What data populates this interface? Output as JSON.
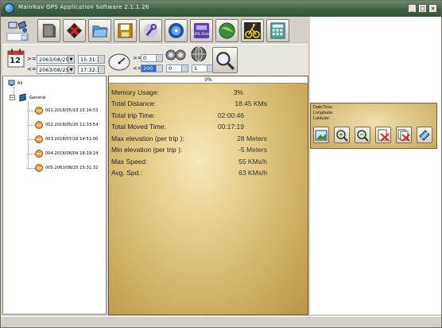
{
  "window": {
    "title": "MainNav GPS Application Software 2.1.1.26"
  },
  "titlebar_buttons": {
    "minimize": "_",
    "maximize": "□",
    "close": "×"
  },
  "toolbar": [
    {
      "name": "open-log-button",
      "icon": "satellite-connect-icon"
    },
    {
      "name": "back-button",
      "icon": "back-arrow-icon"
    },
    {
      "name": "delete-button",
      "icon": "delete-icon"
    },
    {
      "name": "open-folder-button",
      "icon": "folder-icon"
    },
    {
      "name": "save-button",
      "icon": "floppy-disk-icon"
    },
    {
      "name": "settings-button",
      "icon": "tools-icon"
    },
    {
      "name": "globe-button",
      "icon": "globe-icon"
    },
    {
      "name": "gps-data-button",
      "icon": "gps-data-icon"
    },
    {
      "name": "map-button",
      "icon": "map-icon"
    },
    {
      "name": "cycling-button",
      "icon": "cyclist-icon"
    },
    {
      "name": "calculator-button",
      "icon": "calculator-icon"
    }
  ],
  "gps_data_icon_label": "GPS Data",
  "date_filter": {
    "calendar_day": "12",
    "from_label": ">=",
    "to_label": "<=",
    "from_date": "2063/08/25",
    "from_time": "15:31:32",
    "to_date": "2063/08/25",
    "to_time": "17:32:18"
  },
  "speed_filter": {
    "min_label": ">=",
    "max_label": "<=",
    "min_value": "0",
    "max_value": "200"
  },
  "distance_filter": {
    "value_a": "0",
    "value_b": "1"
  },
  "tree": {
    "root": "All",
    "group": "General",
    "tracks": [
      "001.2018/05/19 16:14:53",
      "002.2018/05/20 11:33:54",
      "003.2018/07/29 14:51:00",
      "004.2018/08/04 18:19:24",
      "005.2063/08/25 15:31:32"
    ]
  },
  "progress": {
    "label": "0%",
    "percent": 0
  },
  "stats": [
    {
      "label": "Memory Usage:",
      "value": "3%"
    },
    {
      "label": "Total Distance:",
      "value": "18.45 KMs"
    },
    {
      "label": "Total trip Time:",
      "value": "02:00:46"
    },
    {
      "label": "Total Moved Time:",
      "value": "00:17:19"
    },
    {
      "label": "Max elevation (per trip ):",
      "value": "28 Meters"
    },
    {
      "label": "Min elevation (per trip ):",
      "value": "-5 Meters"
    },
    {
      "label": "Max Speed:",
      "value": "55 KMs/h"
    },
    {
      "label": "Avg. Spd.:",
      "value": "63 KMs/h"
    }
  ],
  "map_panel": {
    "datetime_label": "DateTime:",
    "longitude_label": "Longitude:",
    "latitude_label": "Latitude:",
    "tools": [
      {
        "name": "map-view-button",
        "icon": "landscape-icon"
      },
      {
        "name": "zoom-in-button",
        "icon": "zoom-in-icon"
      },
      {
        "name": "zoom-out-button",
        "icon": "zoom-out-icon"
      },
      {
        "name": "clear-point-button",
        "icon": "cross-icon"
      },
      {
        "name": "clear-all-button",
        "icon": "cross-multiple-icon"
      },
      {
        "name": "export-button",
        "icon": "export-icon"
      }
    ]
  },
  "colors": {
    "titlebar": "#3f5f42",
    "panel_gold": "#d4b86e",
    "selection": "#316ac5"
  }
}
